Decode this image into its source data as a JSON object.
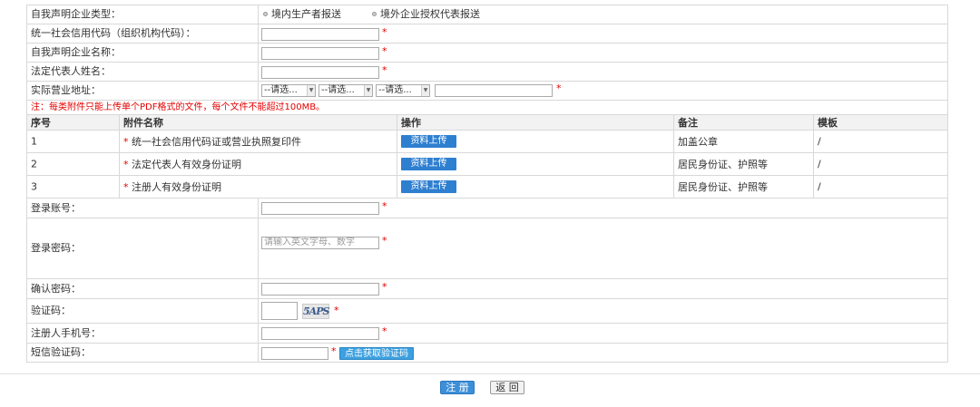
{
  "enterprise_type": {
    "label": "自我声明企业类型：",
    "options": [
      "境内生产者报送",
      "境外企业授权代表报送"
    ]
  },
  "fields": {
    "credit_code": "统一社会信用代码（组织机构代码）：",
    "company_name": "自我声明企业名称：",
    "legal_rep": "法定代表人姓名：",
    "address": "实际营业地址："
  },
  "address_selects": [
    "--请选...",
    "--请选...",
    "--请选..."
  ],
  "required_mark": "*",
  "attachment_note": "注：每类附件只能上传单个PDF格式的文件，每个文件不能超过100MB。",
  "table": {
    "headers": [
      "序号",
      "附件名称",
      "操作",
      "备注",
      "模板"
    ],
    "rows": [
      {
        "no": "1",
        "name": "统一社会信用代码证或营业执照复印件",
        "action": "资料上传",
        "remark": "加盖公章",
        "template": "/"
      },
      {
        "no": "2",
        "name": "法定代表人有效身份证明",
        "action": "资料上传",
        "remark": "居民身份证、护照等",
        "template": "/"
      },
      {
        "no": "3",
        "name": "注册人有效身份证明",
        "action": "资料上传",
        "remark": "居民身份证、护照等",
        "template": "/"
      }
    ]
  },
  "account": {
    "login_label": "登录账号：",
    "password_label": "登录密码：",
    "password_placeholder": "请输入英文字母、数字",
    "confirm_label": "确认密码：",
    "captcha_label": "验证码：",
    "captcha_text": "5APS",
    "phone_label": "注册人手机号：",
    "sms_label": "短信验证码：",
    "sms_button": "点击获取验证码"
  },
  "buttons": {
    "register": "注 册",
    "back": "返 回"
  }
}
